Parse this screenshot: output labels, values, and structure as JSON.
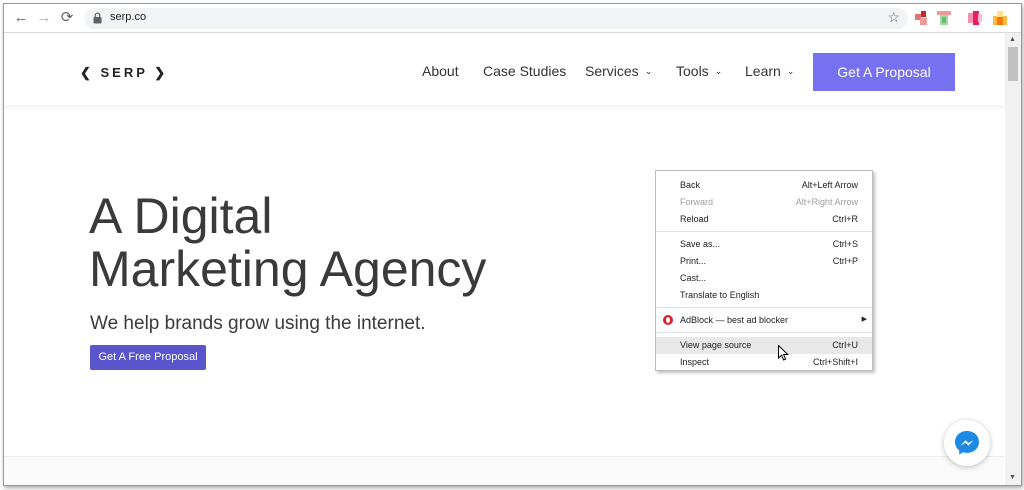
{
  "browser": {
    "url": "serp.co",
    "back_icon": "←",
    "forward_icon": "→",
    "reload_icon": "⟳",
    "star_icon": "☆"
  },
  "site": {
    "logo": "❮ SERP ❯",
    "nav": {
      "about": "About",
      "case_studies": "Case Studies",
      "services": "Services",
      "tools": "Tools",
      "learn": "Learn"
    },
    "caret": "⌄",
    "cta": "Get A Proposal"
  },
  "hero": {
    "title_line1": "A Digital",
    "title_line2": "Marketing Agency",
    "subtitle": "We help brands grow using the internet.",
    "button": "Get A Free Proposal"
  },
  "context_menu": {
    "back": {
      "label": "Back",
      "shortcut": "Alt+Left Arrow"
    },
    "forward": {
      "label": "Forward",
      "shortcut": "Alt+Right Arrow"
    },
    "reload": {
      "label": "Reload",
      "shortcut": "Ctrl+R"
    },
    "save_as": {
      "label": "Save as...",
      "shortcut": "Ctrl+S"
    },
    "print": {
      "label": "Print...",
      "shortcut": "Ctrl+P"
    },
    "cast": {
      "label": "Cast..."
    },
    "translate": {
      "label": "Translate to English"
    },
    "adblock": {
      "label": "AdBlock — best ad blocker"
    },
    "view_source": {
      "label": "View page source",
      "shortcut": "Ctrl+U"
    },
    "inspect": {
      "label": "Inspect",
      "shortcut": "Ctrl+Shift+I"
    }
  },
  "colors": {
    "accent": "#7671f0",
    "hero_button": "#5a55cc",
    "opera_red": "#e0212f",
    "messenger_blue": "#1e88e5"
  }
}
